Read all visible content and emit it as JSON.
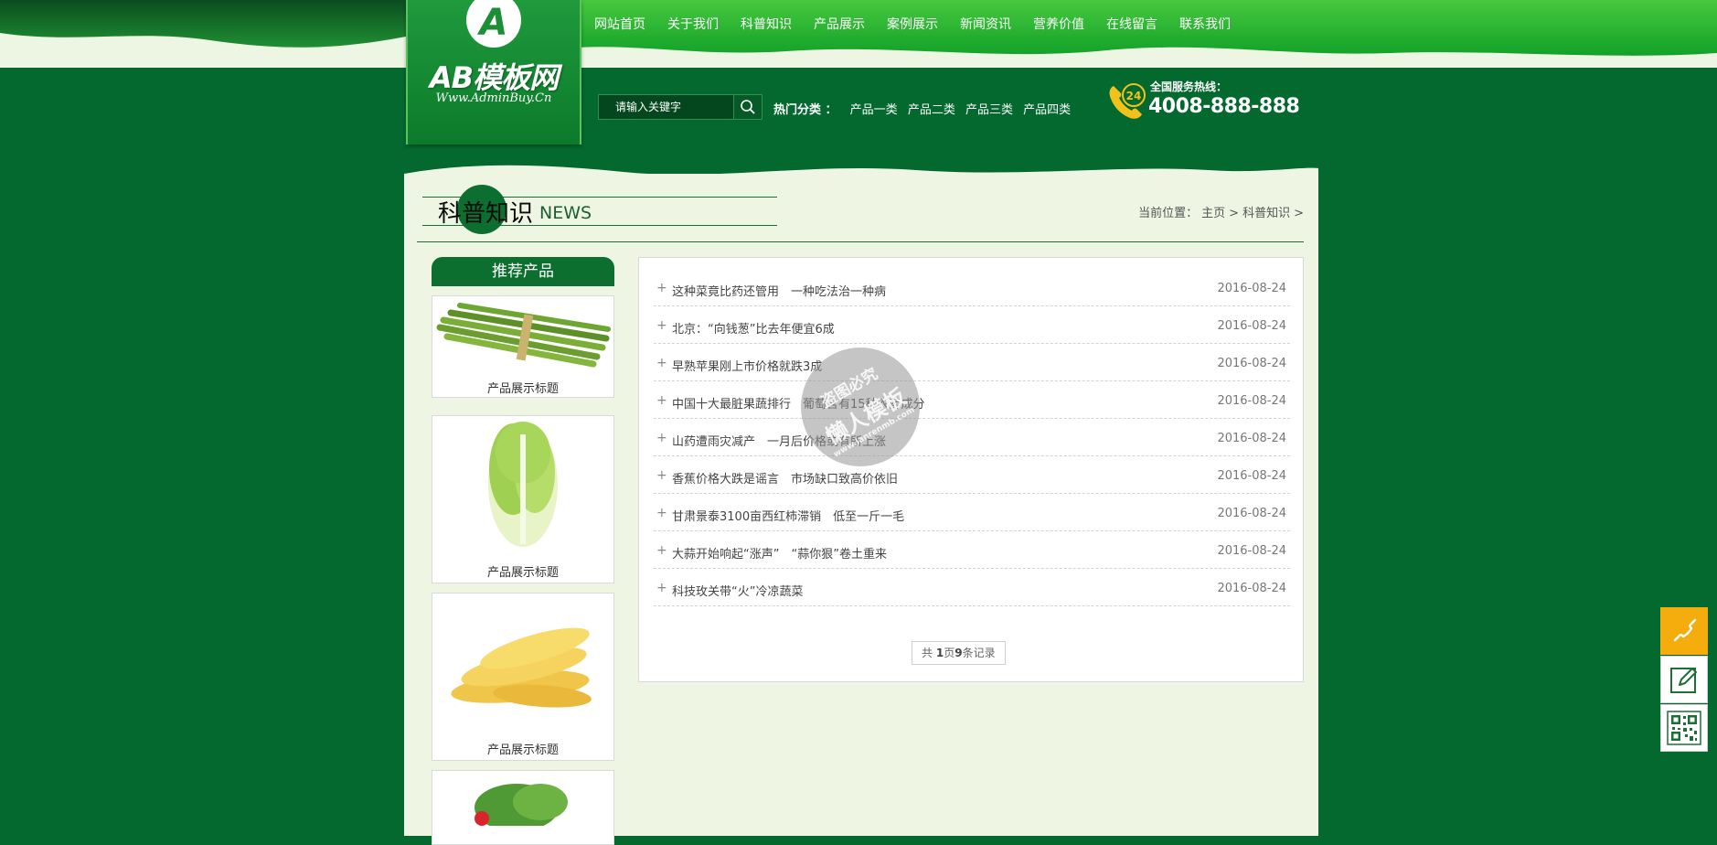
{
  "logo": {
    "title": "AB模板网",
    "subtitle": "Www.AdminBuy.Cn"
  },
  "nav": [
    "网站首页",
    "关于我们",
    "科普知识",
    "产品展示",
    "案例展示",
    "新闻资讯",
    "营养价值",
    "在线留言",
    "联系我们"
  ],
  "search": {
    "placeholder": "请输入关键字"
  },
  "hot": {
    "label": "热门分类 ：",
    "items": [
      "产品一类",
      "产品二类",
      "产品三类",
      "产品四类"
    ]
  },
  "hotline": {
    "label": "全国服务热线：",
    "number": "4008-888-888",
    "badge": "24"
  },
  "section": {
    "title_cn": "科普知识",
    "title_en": "NEWS"
  },
  "breadcrumb": {
    "prefix": "当前位置：",
    "home": "主页",
    "sep": ">",
    "current": "科普知识",
    "trail": ">"
  },
  "sidebar": {
    "heading": "推荐产品",
    "products": [
      {
        "caption": "产品展示标题",
        "image": "asparagus"
      },
      {
        "caption": "产品展示标题",
        "image": "cabbage"
      },
      {
        "caption": "产品展示标题",
        "image": "corn"
      },
      {
        "caption": "",
        "image": "salad"
      }
    ]
  },
  "news": [
    {
      "title": "这种菜竟比药还管用　一种吃法治一种病",
      "date": "2016-08-24"
    },
    {
      "title": "北京：“向钱葱”比去年便宜6成",
      "date": "2016-08-24"
    },
    {
      "title": "早熟苹果刚上市价格就跌3成",
      "date": "2016-08-24"
    },
    {
      "title": "中国十大最脏果蔬排行　葡萄含有15种农药成分",
      "date": "2016-08-24"
    },
    {
      "title": "山药遭雨灾减产　一月后价格或有所上涨",
      "date": "2016-08-24"
    },
    {
      "title": "香蕉价格大跌是谣言　市场缺口致高价依旧",
      "date": "2016-08-24"
    },
    {
      "title": "甘肃景泰3100亩西红柿滞销　低至一斤一毛",
      "date": "2016-08-24"
    },
    {
      "title": "大蒜开始响起“涨声”　“蒜你狠”卷土重来",
      "date": "2016-08-24"
    },
    {
      "title": "科技玫关带“火”冷凉蔬菜",
      "date": "2016-08-24"
    }
  ],
  "pager": {
    "prefix": "共 ",
    "pages": "1",
    "mid": "页",
    "records": "9",
    "suffix": "条记录"
  },
  "watermark": {
    "line1": "盗图必究",
    "line2": "懒人模板",
    "line3": "www.lanrenmb.com"
  },
  "floating": [
    "phone-icon",
    "edit-icon",
    "qrcode-icon"
  ],
  "colors": {
    "brand_green": "#03692e",
    "panel_bg": "#eef5e3",
    "float_yellow": "#f5ad0d"
  }
}
